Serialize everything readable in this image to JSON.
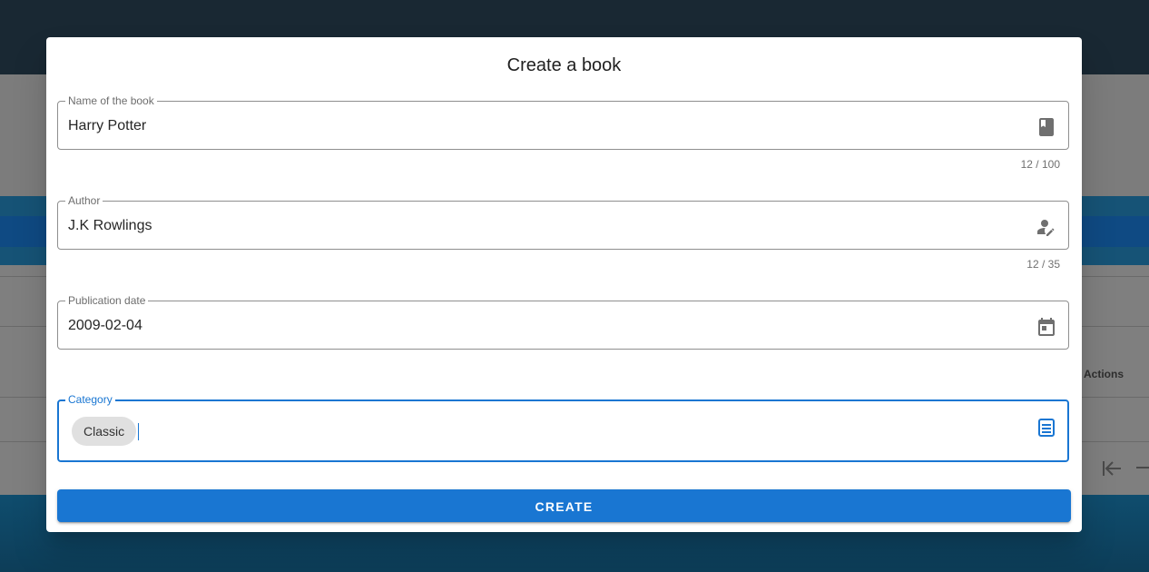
{
  "background": {
    "table_header_actions": "Actions"
  },
  "dialog": {
    "title": "Create a book",
    "fields": {
      "name": {
        "label": "Name of the book",
        "value": "Harry Potter",
        "counter": "12 / 100",
        "icon": "book-icon"
      },
      "author": {
        "label": "Author",
        "value": "J.K Rowlings",
        "counter": "12 / 35",
        "icon": "person-edit-icon"
      },
      "publication_date": {
        "label": "Publication date",
        "value": "2009-02-04",
        "icon": "calendar-icon"
      },
      "category": {
        "label": "Category",
        "chips": [
          "Classic"
        ],
        "icon": "category-list-icon"
      }
    },
    "create_label": "CREATE"
  },
  "colors": {
    "primary": "#1976d2",
    "overlay_header": "#192833",
    "chip_bg": "#e0e0e0"
  }
}
